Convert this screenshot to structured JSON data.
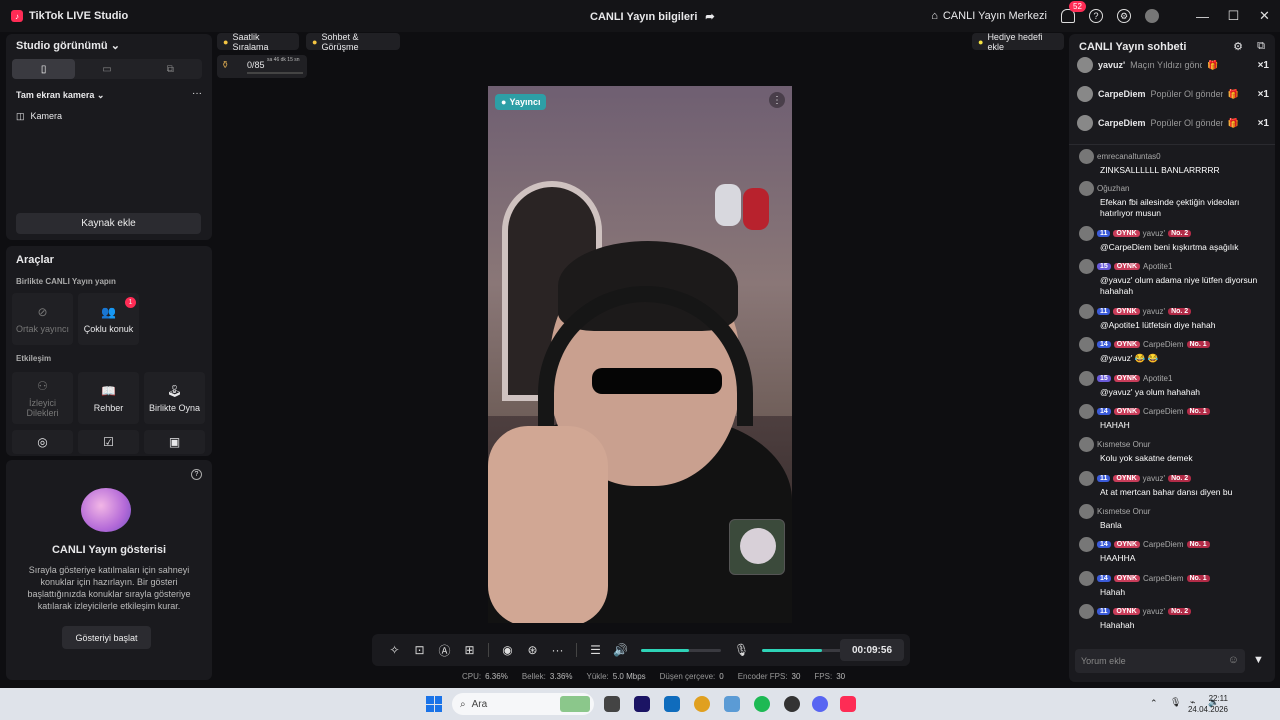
{
  "app": {
    "name": "TikTok LIVE Studio",
    "live_info": "CANLI Yayın bilgileri",
    "live_center": "CANLI Yayın Merkezi",
    "notif_count": "52"
  },
  "studio": {
    "view_label": "Studio görünümü",
    "camera_section": "Tam ekran kamera",
    "camera_item": "Kamera",
    "add_source": "Kaynak ekle"
  },
  "tools": {
    "title": "Araçlar",
    "together": "Birlikte CANLI Yayın yapın",
    "co_host": "Ortak yayıncı",
    "multi_guest": "Çoklu konuk",
    "multi_badge": "1",
    "engagement": "Etkileşim",
    "requests": "İzleyici Dilekleri",
    "guide": "Rehber",
    "play_together": "Birlikte Oyna"
  },
  "show": {
    "title": "CANLI Yayın gösterisi",
    "desc": "Sırayla gösteriye katılmaları için sahneyi konuklar için hazırlayın. Bir gösteri başlattığınızda konuklar sırayla gösteriye katılarak izleyicilerle etkileşim kurar.",
    "start": "Gösteriyi başlat"
  },
  "top": {
    "hourly": "Saatlik Sıralama",
    "chat_meet": "Sohbet & Görüşme",
    "gift_goal": "Hediye hedefi ekle",
    "goal_value": "0/85",
    "goal_time": "sa 46 dk 15 sn"
  },
  "video": {
    "host_label": "Yayıncı",
    "timer": "00:09:56",
    "volume_level": 0.6,
    "mic_level": 0.75
  },
  "stats": [
    {
      "k": "CPU:",
      "v": "6.36%"
    },
    {
      "k": "Bellek:",
      "v": "3.36%"
    },
    {
      "k": "Yükle:",
      "v": "5.0 Mbps"
    },
    {
      "k": "Düşen çerçeve:",
      "v": "0"
    },
    {
      "k": "Encoder FPS:",
      "v": "30"
    },
    {
      "k": "FPS:",
      "v": "30"
    }
  ],
  "chat": {
    "title": "CANLI Yayın sohbeti",
    "placeholder": "Yorum ekle",
    "gifts": [
      {
        "name": "yavuz'",
        "text": "Maçın Yıldızı gönderildi",
        "count": "×1"
      },
      {
        "name": "CarpeDiem",
        "text": "Popüler Ol gönderildi",
        "count": "×1"
      },
      {
        "name": "CarpeDiem",
        "text": "Popüler Ol gönderildi",
        "count": "×1"
      }
    ],
    "messages": [
      {
        "user": "emrecanaltuntas0",
        "lvl": "",
        "fan": "",
        "no": "",
        "text": "ZINKSALLLLLL BANLARRRRR"
      },
      {
        "user": "Oğuzhan",
        "lvl": "",
        "fan": "",
        "no": "",
        "text": "Efekan fbi ailesinde çektiğin videoları hatırlıyor musun"
      },
      {
        "user": "yavuz'",
        "lvl": "11",
        "fan": "OYNK",
        "no": "No. 2",
        "text": "@CarpeDiem beni kışkırtma aşağılık"
      },
      {
        "user": "Apotite1",
        "lvl": "15",
        "fan": "OYNK",
        "no": "",
        "text": "@yavuz' olum adama niye lütfen diyorsun hahahah"
      },
      {
        "user": "yavuz'",
        "lvl": "11",
        "fan": "OYNK",
        "no": "No. 2",
        "text": "@Apotite1 lütfetsin diye hahah"
      },
      {
        "user": "CarpeDiem",
        "lvl": "14",
        "fan": "OYNK",
        "no": "No. 1",
        "text": "@yavuz' 😂 😂"
      },
      {
        "user": "Apotite1",
        "lvl": "15",
        "fan": "OYNK",
        "no": "",
        "text": "@yavuz' ya olum hahahah"
      },
      {
        "user": "CarpeDiem",
        "lvl": "14",
        "fan": "OYNK",
        "no": "No. 1",
        "text": "HAHAH"
      },
      {
        "user": "Kısmetse Onur",
        "lvl": "",
        "fan": "",
        "no": "",
        "text": "Kolu yok sakatne demek"
      },
      {
        "user": "yavuz'",
        "lvl": "11",
        "fan": "OYNK",
        "no": "No. 2",
        "text": "At at mertcan bahar dansı diyen bu"
      },
      {
        "user": "Kısmetse Onur",
        "lvl": "",
        "fan": "",
        "no": "",
        "text": "Banla"
      },
      {
        "user": "CarpeDiem",
        "lvl": "14",
        "fan": "OYNK",
        "no": "No. 1",
        "text": "HAAHHA"
      },
      {
        "user": "CarpeDiem",
        "lvl": "14",
        "fan": "OYNK",
        "no": "No. 1",
        "text": "Hahah"
      },
      {
        "user": "yavuz'",
        "lvl": "11",
        "fan": "OYNK",
        "no": "No. 2",
        "text": "Hahahah"
      }
    ]
  },
  "taskbar": {
    "search": "Ara",
    "time": "22:11",
    "date": "24.04.2026"
  }
}
